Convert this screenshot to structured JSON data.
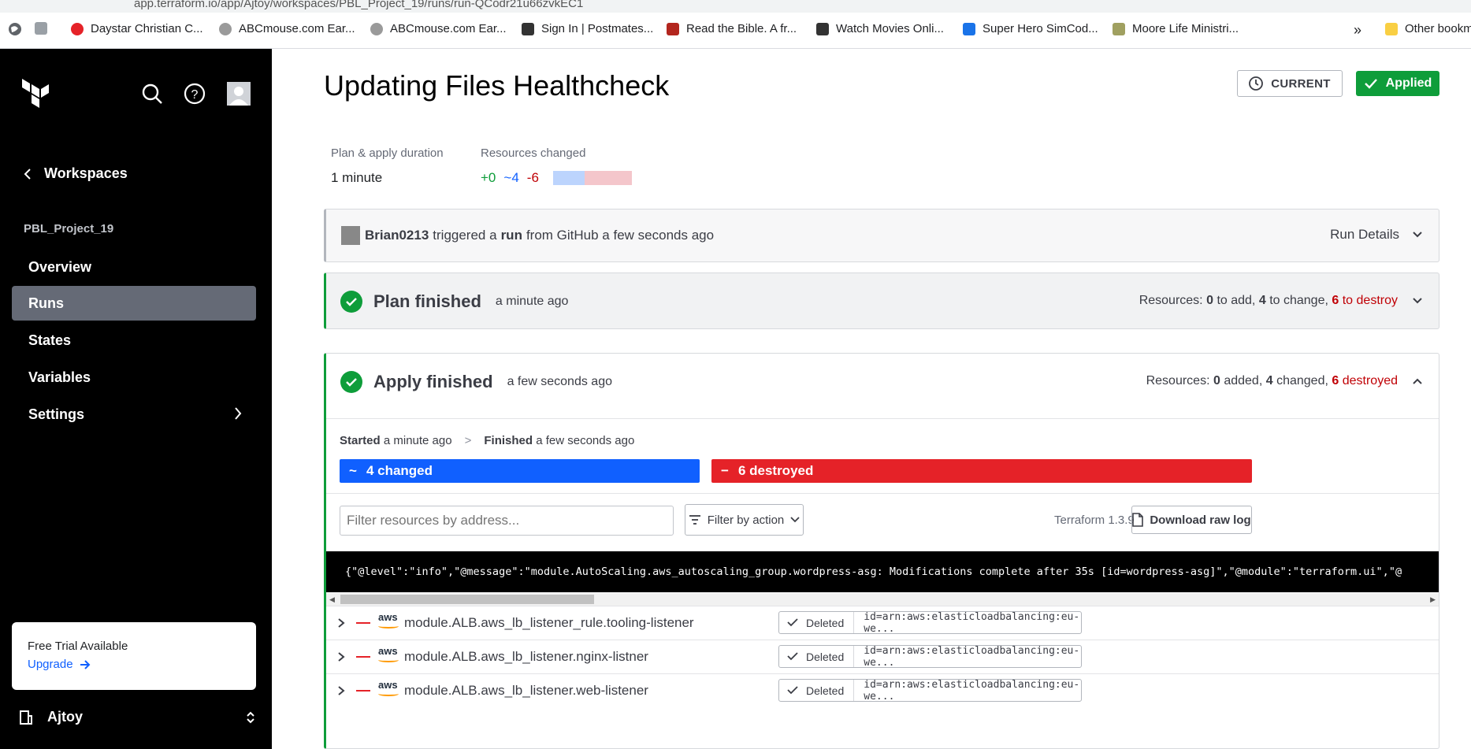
{
  "browser": {
    "url": "app.terraform.io/app/Ajtoy/workspaces/PBL_Project_19/runs/run-QCodr21u66zvkEC1",
    "bookmarks": [
      {
        "label": "Daystar Christian C...",
        "color": "#e52228"
      },
      {
        "label": "ABCmouse.com Ear...",
        "color": "#9a9a9a"
      },
      {
        "label": "ABCmouse.com Ear...",
        "color": "#9a9a9a"
      },
      {
        "label": "Sign In | Postmates...",
        "color": "#333333"
      },
      {
        "label": "Read the Bible. A fr...",
        "color": "#b3261e"
      },
      {
        "label": "Watch Movies Onli...",
        "color": "#333333"
      },
      {
        "label": "Super Hero SimCod...",
        "color": "#1a73e8"
      },
      {
        "label": "Moore Life Ministri...",
        "color": "#a0a060"
      }
    ],
    "overflow": "»",
    "other_bookmarks": "Other bookm"
  },
  "sidebar": {
    "back_label": "Workspaces",
    "project": "PBL_Project_19",
    "nav": [
      {
        "label": "Overview"
      },
      {
        "label": "Runs"
      },
      {
        "label": "States"
      },
      {
        "label": "Variables"
      },
      {
        "label": "Settings"
      }
    ],
    "trial_title": "Free Trial Available",
    "trial_link": "Upgrade",
    "org": "Ajtoy"
  },
  "header": {
    "title": "Updating Files Healthcheck",
    "current_label": "CURRENT",
    "status_label": "Applied"
  },
  "stats": {
    "duration_label": "Plan & apply duration",
    "duration_value": "1 minute",
    "resources_label": "Resources changed",
    "added": "+0",
    "changed": "~4",
    "destroyed": "-6",
    "colors": {
      "added": "#0e9d3a",
      "changed": "#1060ff",
      "destroyed": "#c00005"
    }
  },
  "trigger": {
    "user": "Brian0213",
    "text1": "triggered a",
    "run": "run",
    "text2": "from GitHub a few seconds ago",
    "details": "Run Details"
  },
  "plan": {
    "title": "Plan finished",
    "time": "a minute ago",
    "res_prefix": "Resources:",
    "add": "0",
    "add_text": "to add,",
    "change": "4",
    "change_text": "to change,",
    "destroy": "6",
    "destroy_text": "to destroy"
  },
  "apply": {
    "title": "Apply finished",
    "time": "a few seconds ago",
    "res_prefix": "Resources:",
    "added": "0",
    "added_text": "added,",
    "changed": "4",
    "changed_text": "changed,",
    "destroyed": "6",
    "destroyed_text": "destroyed",
    "started_label": "Started",
    "started_time": "a minute ago",
    "sep": ">",
    "finished_label": "Finished",
    "finished_time": "a few seconds ago",
    "changed_bar": "4 changed",
    "destroyed_bar": "6 destroyed",
    "filter_placeholder": "Filter resources by address...",
    "filter_action": "Filter by action",
    "tf_version": "Terraform 1.3.9",
    "download": "Download raw log",
    "log_line": "{\"@level\":\"info\",\"@message\":\"module.AutoScaling.aws_autoscaling_group.wordpress-asg: Modifications complete after 35s [id=wordpress-asg]\",\"@module\":\"terraform.ui\",\"@"
  },
  "resources": [
    {
      "name": "module.ALB.aws_lb_listener_rule.tooling-listener",
      "status": "Deleted",
      "id": "id=arn:aws:elasticloadbalancing:eu-we..."
    },
    {
      "name": "module.ALB.aws_lb_listener.nginx-listner",
      "status": "Deleted",
      "id": "id=arn:aws:elasticloadbalancing:eu-we..."
    },
    {
      "name": "module.ALB.aws_lb_listener.web-listener",
      "status": "Deleted",
      "id": "id=arn:aws:elasticloadbalancing:eu-we..."
    }
  ],
  "aws_label": "aws"
}
